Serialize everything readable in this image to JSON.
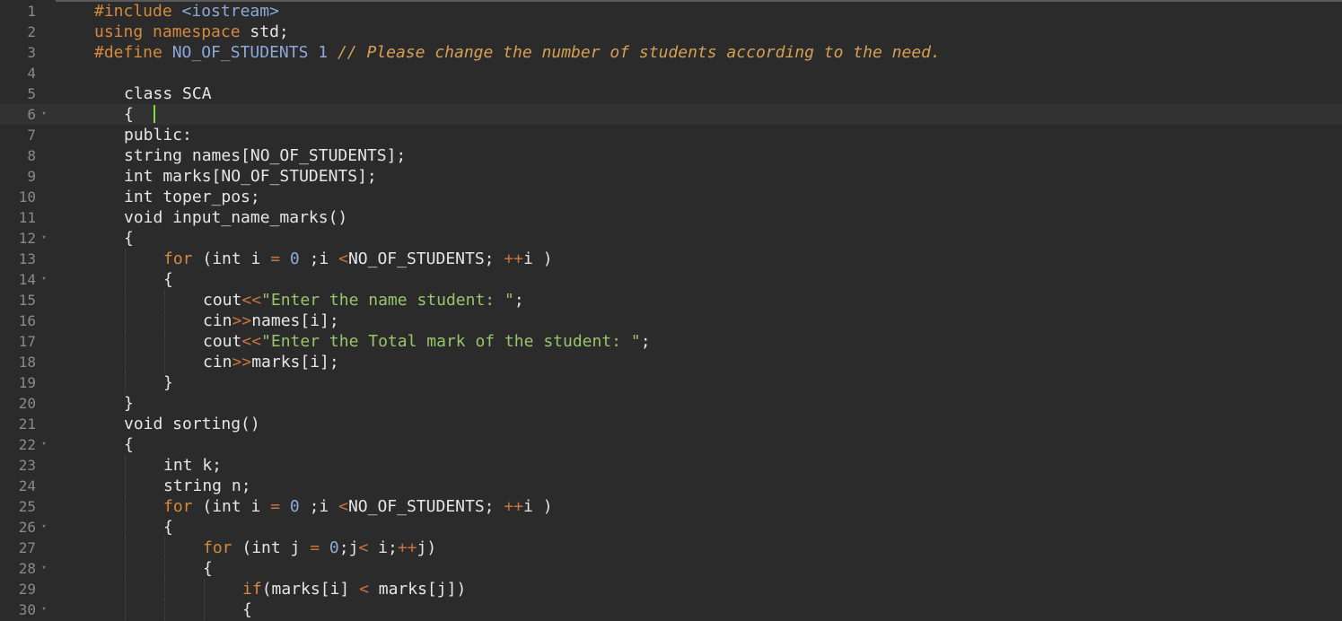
{
  "editor": {
    "active_line": 6,
    "lines": [
      {
        "n": "1",
        "fold": false,
        "indent": 0,
        "segs": [
          {
            "t": "#include ",
            "c": "kw"
          },
          {
            "t": "<iostream>",
            "c": "num"
          }
        ]
      },
      {
        "n": "2",
        "fold": false,
        "indent": 0,
        "segs": [
          {
            "t": "using ",
            "c": "kw"
          },
          {
            "t": "namespace ",
            "c": "kw"
          },
          {
            "t": "std;",
            "c": ""
          }
        ]
      },
      {
        "n": "3",
        "fold": false,
        "indent": 0,
        "segs": [
          {
            "t": "#define ",
            "c": "kw"
          },
          {
            "t": "NO_OF_STUDENTS ",
            "c": "num"
          },
          {
            "t": "1 ",
            "c": "num"
          },
          {
            "t": "// Please change the number of students according to the need.",
            "c": "cm"
          }
        ]
      },
      {
        "n": "4",
        "fold": false,
        "indent": 0,
        "segs": []
      },
      {
        "n": "5",
        "fold": false,
        "indent": 1,
        "segs": [
          {
            "t": "class SCA",
            "c": ""
          }
        ]
      },
      {
        "n": "6",
        "fold": true,
        "indent": 1,
        "segs": [
          {
            "t": "{",
            "c": ""
          }
        ]
      },
      {
        "n": "7",
        "fold": false,
        "indent": 1,
        "segs": [
          {
            "t": "public:",
            "c": ""
          }
        ]
      },
      {
        "n": "8",
        "fold": false,
        "indent": 1,
        "segs": [
          {
            "t": "string names[NO_OF_STUDENTS];",
            "c": ""
          }
        ]
      },
      {
        "n": "9",
        "fold": false,
        "indent": 1,
        "segs": [
          {
            "t": "int marks[NO_OF_STUDENTS];",
            "c": ""
          }
        ]
      },
      {
        "n": "10",
        "fold": false,
        "indent": 1,
        "segs": [
          {
            "t": "int toper_pos;",
            "c": ""
          }
        ]
      },
      {
        "n": "11",
        "fold": false,
        "indent": 1,
        "segs": [
          {
            "t": "void input_name_marks()",
            "c": ""
          }
        ]
      },
      {
        "n": "12",
        "fold": true,
        "indent": 1,
        "segs": [
          {
            "t": "{",
            "c": ""
          }
        ]
      },
      {
        "n": "13",
        "fold": false,
        "indent": 2,
        "segs": [
          {
            "t": "for ",
            "c": "kw"
          },
          {
            "t": "(int i ",
            "c": ""
          },
          {
            "t": "= ",
            "c": "op"
          },
          {
            "t": "0 ",
            "c": "num"
          },
          {
            "t": ";i ",
            "c": ""
          },
          {
            "t": "<",
            "c": "op"
          },
          {
            "t": "NO_OF_STUDENTS; ",
            "c": ""
          },
          {
            "t": "++",
            "c": "op"
          },
          {
            "t": "i )",
            "c": ""
          }
        ]
      },
      {
        "n": "14",
        "fold": true,
        "indent": 2,
        "segs": [
          {
            "t": "{",
            "c": ""
          }
        ]
      },
      {
        "n": "15",
        "fold": false,
        "indent": 3,
        "segs": [
          {
            "t": "cout",
            "c": ""
          },
          {
            "t": "<<",
            "c": "op"
          },
          {
            "t": "\"Enter the name student: \"",
            "c": "str"
          },
          {
            "t": ";",
            "c": ""
          }
        ]
      },
      {
        "n": "16",
        "fold": false,
        "indent": 3,
        "segs": [
          {
            "t": "cin",
            "c": ""
          },
          {
            "t": ">>",
            "c": "op"
          },
          {
            "t": "names[i];",
            "c": ""
          }
        ]
      },
      {
        "n": "17",
        "fold": false,
        "indent": 3,
        "segs": [
          {
            "t": "cout",
            "c": ""
          },
          {
            "t": "<<",
            "c": "op"
          },
          {
            "t": "\"Enter the Total mark of the student: \"",
            "c": "str"
          },
          {
            "t": ";",
            "c": ""
          }
        ]
      },
      {
        "n": "18",
        "fold": false,
        "indent": 3,
        "segs": [
          {
            "t": "cin",
            "c": ""
          },
          {
            "t": ">>",
            "c": "op"
          },
          {
            "t": "marks[i];",
            "c": ""
          }
        ]
      },
      {
        "n": "19",
        "fold": false,
        "indent": 2,
        "segs": [
          {
            "t": "}",
            "c": ""
          }
        ]
      },
      {
        "n": "20",
        "fold": false,
        "indent": 1,
        "segs": [
          {
            "t": "}",
            "c": ""
          }
        ]
      },
      {
        "n": "21",
        "fold": false,
        "indent": 1,
        "segs": [
          {
            "t": "void sorting()",
            "c": ""
          }
        ]
      },
      {
        "n": "22",
        "fold": true,
        "indent": 1,
        "segs": [
          {
            "t": "{",
            "c": ""
          }
        ]
      },
      {
        "n": "23",
        "fold": false,
        "indent": 2,
        "segs": [
          {
            "t": "int k;",
            "c": ""
          }
        ]
      },
      {
        "n": "24",
        "fold": false,
        "indent": 2,
        "segs": [
          {
            "t": "string n;",
            "c": ""
          }
        ]
      },
      {
        "n": "25",
        "fold": false,
        "indent": 2,
        "segs": [
          {
            "t": "for ",
            "c": "kw"
          },
          {
            "t": "(int i ",
            "c": ""
          },
          {
            "t": "= ",
            "c": "op"
          },
          {
            "t": "0 ",
            "c": "num"
          },
          {
            "t": ";i ",
            "c": ""
          },
          {
            "t": "<",
            "c": "op"
          },
          {
            "t": "NO_OF_STUDENTS; ",
            "c": ""
          },
          {
            "t": "++",
            "c": "op"
          },
          {
            "t": "i )",
            "c": ""
          }
        ]
      },
      {
        "n": "26",
        "fold": true,
        "indent": 2,
        "segs": [
          {
            "t": "{",
            "c": ""
          }
        ]
      },
      {
        "n": "27",
        "fold": false,
        "indent": 3,
        "segs": [
          {
            "t": "for ",
            "c": "kw"
          },
          {
            "t": "(int j ",
            "c": ""
          },
          {
            "t": "= ",
            "c": "op"
          },
          {
            "t": "0",
            "c": "num"
          },
          {
            "t": ";j",
            "c": ""
          },
          {
            "t": "< ",
            "c": "op"
          },
          {
            "t": "i;",
            "c": ""
          },
          {
            "t": "++",
            "c": "op"
          },
          {
            "t": "j)",
            "c": ""
          }
        ]
      },
      {
        "n": "28",
        "fold": true,
        "indent": 3,
        "segs": [
          {
            "t": "{",
            "c": ""
          }
        ]
      },
      {
        "n": "29",
        "fold": false,
        "indent": 4,
        "segs": [
          {
            "t": "if",
            "c": "kw"
          },
          {
            "t": "(marks[i] ",
            "c": ""
          },
          {
            "t": "< ",
            "c": "op"
          },
          {
            "t": "marks[j])",
            "c": ""
          }
        ]
      },
      {
        "n": "30",
        "fold": true,
        "indent": 4,
        "segs": [
          {
            "t": "{",
            "c": ""
          }
        ]
      }
    ]
  }
}
